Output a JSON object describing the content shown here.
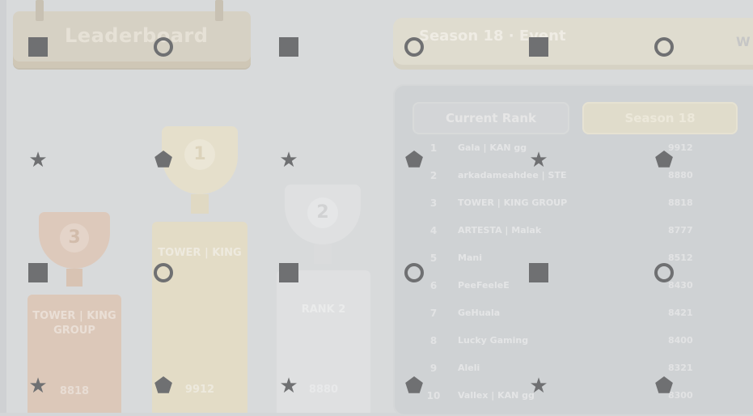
{
  "title": "Leaderboard",
  "season_header": "Season 18 · Event",
  "corner_mark": "W",
  "tabs": {
    "current": "Current Rank",
    "season": "Season 18"
  },
  "podium": [
    {
      "place": "1",
      "name": "TOWER | KING",
      "score": "9912",
      "color": "#e3dcc6"
    },
    {
      "place": "2",
      "name": "RANK 2",
      "score": "8880",
      "color": "#dfe0e1"
    },
    {
      "place": "3",
      "name": "TOWER | KING GROUP",
      "score": "8818",
      "color": "#dcc8b9"
    }
  ],
  "rows": [
    {
      "rank": "1",
      "name": "Gala | KAN gg",
      "points": "9912"
    },
    {
      "rank": "2",
      "name": "arkadameahdee | STE",
      "points": "8880"
    },
    {
      "rank": "3",
      "name": "TOWER | KING GROUP",
      "points": "8818"
    },
    {
      "rank": "4",
      "name": "ARTESTA | Malak",
      "points": "8777"
    },
    {
      "rank": "5",
      "name": "Mani",
      "points": "8512"
    },
    {
      "rank": "6",
      "name": "PeeFeeleE",
      "points": "8430"
    },
    {
      "rank": "7",
      "name": "GeHuala",
      "points": "8421"
    },
    {
      "rank": "8",
      "name": "Lucky Gaming",
      "points": "8400"
    },
    {
      "rank": "9",
      "name": "Aleli",
      "points": "8321"
    },
    {
      "rank": "10",
      "name": "Vallex | KAN gg",
      "points": "8300"
    }
  ],
  "overlay_markers": [
    {
      "shape": "square"
    },
    {
      "shape": "ring"
    },
    {
      "shape": "square"
    },
    {
      "shape": "ring"
    },
    {
      "shape": "square"
    },
    {
      "shape": "ring"
    },
    {
      "shape": "star",
      "glyph": "★"
    },
    {
      "shape": "pentagon",
      "glyph": "⬟"
    },
    {
      "shape": "star",
      "glyph": "★"
    },
    {
      "shape": "pentagon",
      "glyph": "⬟"
    },
    {
      "shape": "star",
      "glyph": "★"
    },
    {
      "shape": "pentagon",
      "glyph": "⬟"
    },
    {
      "shape": "square"
    },
    {
      "shape": "ring"
    },
    {
      "shape": "square"
    },
    {
      "shape": "ring"
    },
    {
      "shape": "square"
    },
    {
      "shape": "ring"
    },
    {
      "shape": "star",
      "glyph": "★"
    },
    {
      "shape": "pentagon",
      "glyph": "⬟"
    },
    {
      "shape": "star",
      "glyph": "★"
    },
    {
      "shape": "pentagon",
      "glyph": "⬟"
    },
    {
      "shape": "star",
      "glyph": "★"
    },
    {
      "shape": "pentagon",
      "glyph": "⬟"
    }
  ]
}
